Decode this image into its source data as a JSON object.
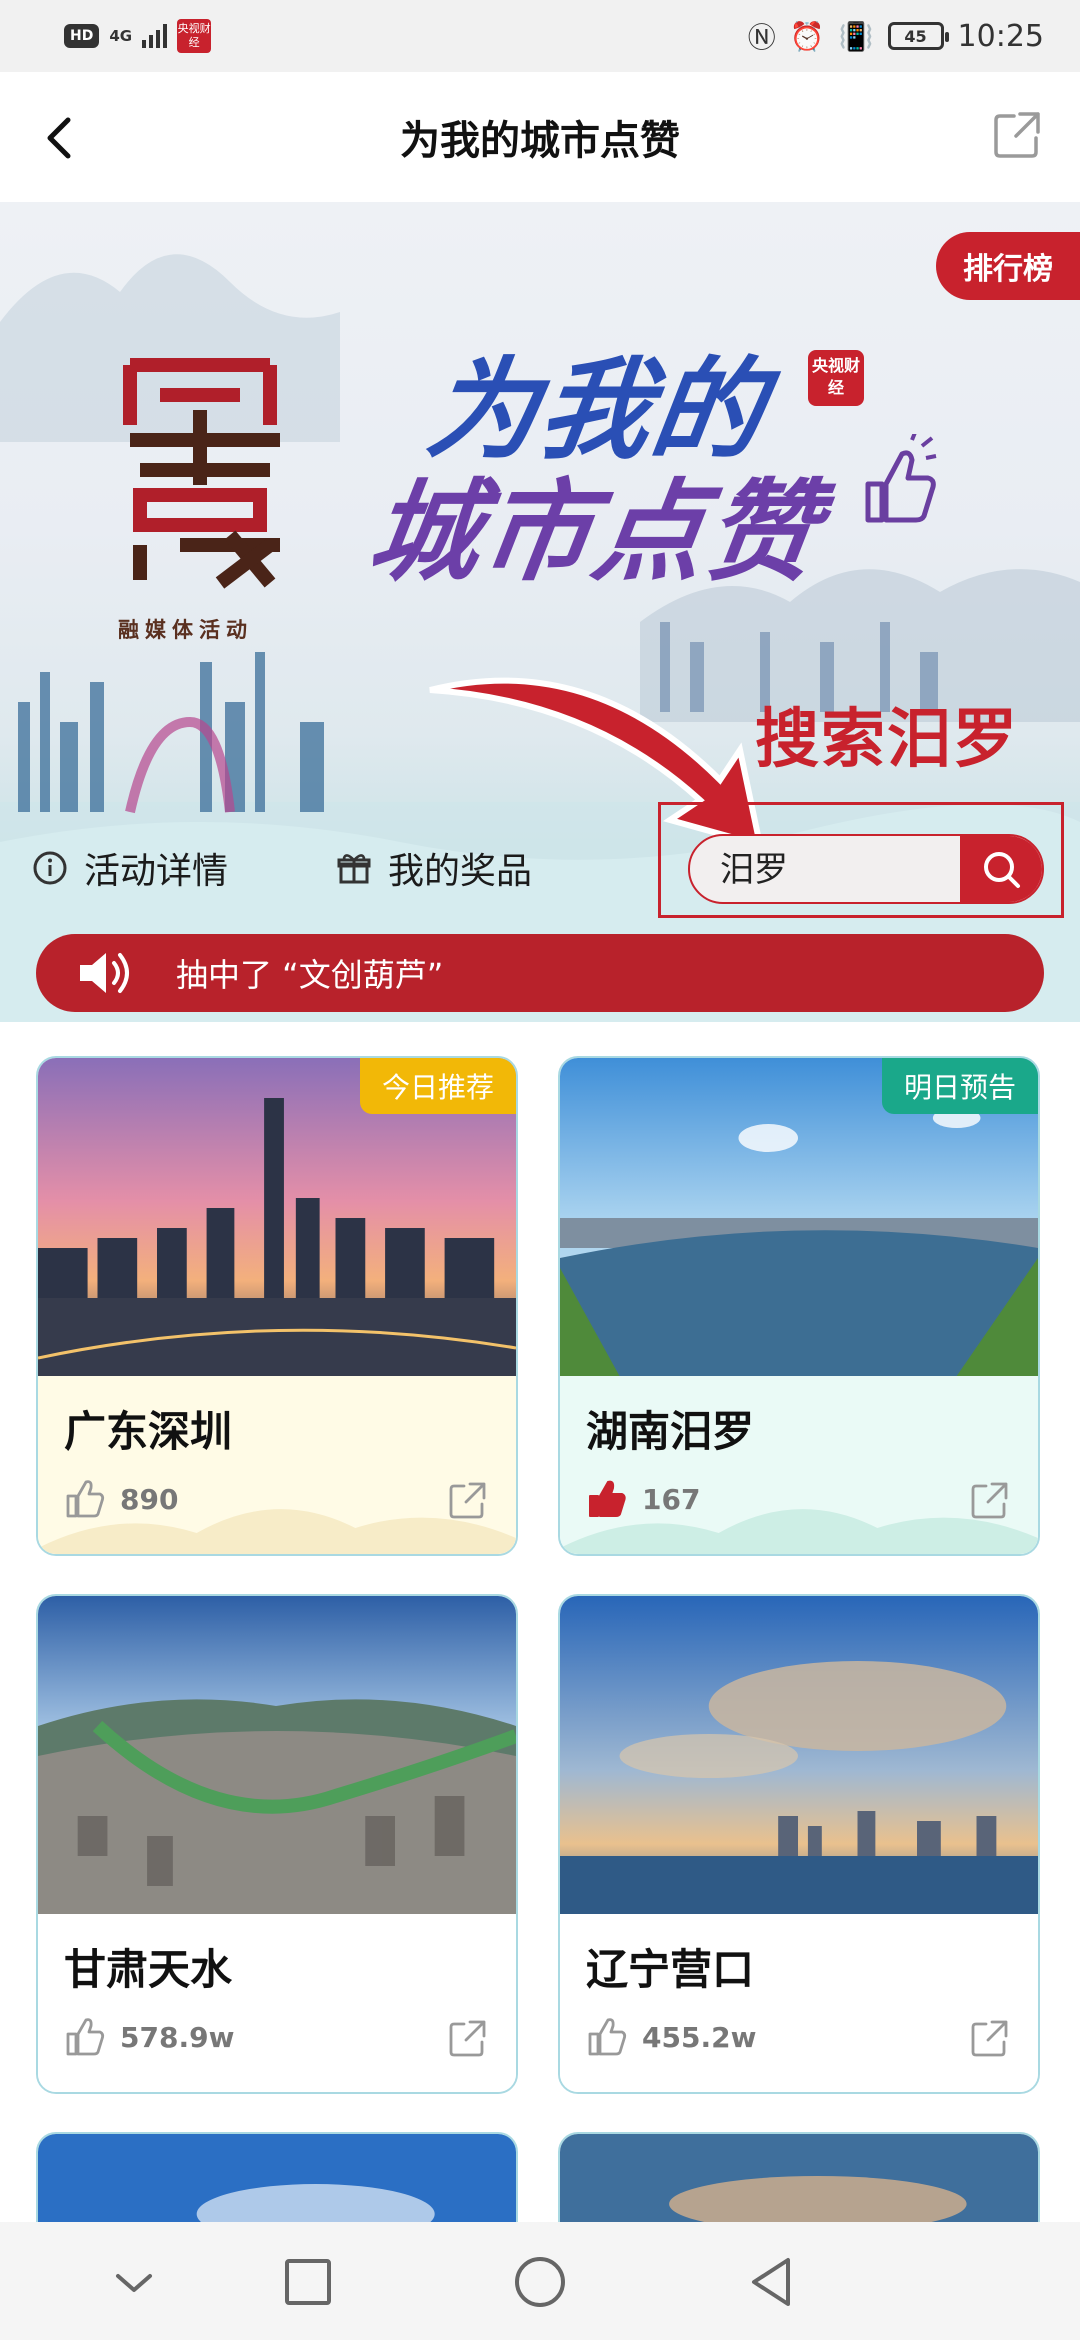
{
  "status_bar": {
    "hd": "HD",
    "network": "4G",
    "app_badge": "央视财经",
    "battery": "45",
    "time": "10:25"
  },
  "header": {
    "title": "为我的城市点赞"
  },
  "banner": {
    "ranking_label": "排行榜",
    "logo_caption": "融媒体活动",
    "headline_line1": "为我的",
    "headline_line2": "城市点赞",
    "cctv_badge": "央视财经",
    "search_hint": "搜索汨罗"
  },
  "actions": {
    "details_label": "活动详情",
    "prizes_label": "我的奖品"
  },
  "search": {
    "value": "汨罗"
  },
  "notice": {
    "text": "抽中了 “文创葫芦”"
  },
  "cards": [
    {
      "name": "广东深圳",
      "likes": "890",
      "tag": "今日推荐",
      "tag_color": "#f2b807",
      "liked": false,
      "icon": "thumbs-up-outline-icon"
    },
    {
      "name": "湖南汨罗",
      "likes": "167",
      "tag": "明日预告",
      "tag_color": "#1aa88a",
      "liked": true,
      "icon": "thumbs-up-filled-icon"
    },
    {
      "name": "甘肃天水",
      "likes": "578.9w",
      "tag": "",
      "liked": false,
      "icon": "thumbs-up-outline-icon"
    },
    {
      "name": "辽宁营口",
      "likes": "455.2w",
      "tag": "",
      "liked": false,
      "icon": "thumbs-up-outline-icon"
    }
  ],
  "colors": {
    "brand_red": "#c8222d",
    "card_border": "#a9d9e2"
  }
}
